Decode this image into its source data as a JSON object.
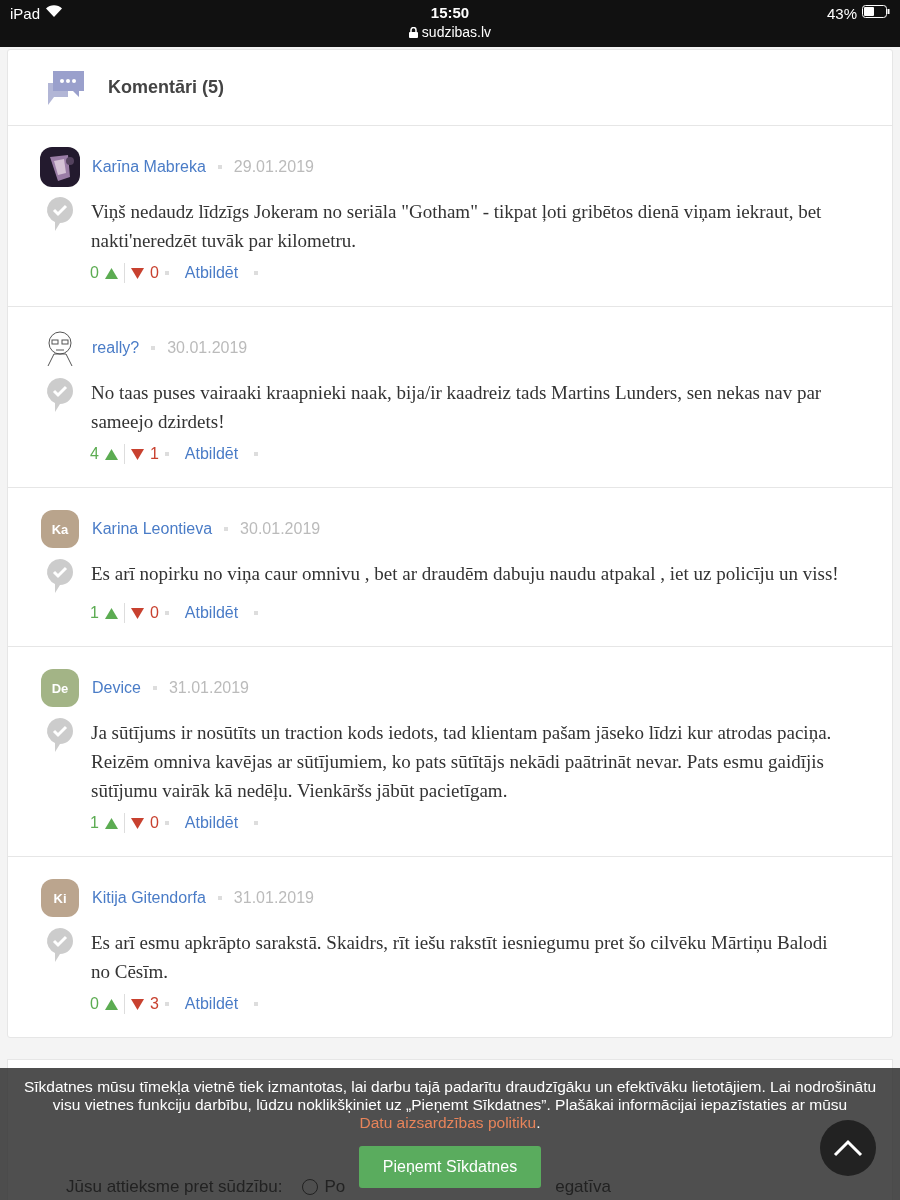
{
  "status_bar": {
    "device": "iPad",
    "time": "15:50",
    "url": "sudzibas.lv",
    "battery": "43%"
  },
  "comments_header": {
    "title": "Komentāri (5)"
  },
  "comments": [
    {
      "name": "Karīna Mabreka",
      "date": "29.01.2019",
      "text": "Viņš nedaudz līdzīgs Jokeram no seriāla \"Gotham\" - tikpat ļoti gribētos dienā viņam iekraut, bet nakti'neredzēt tuvāk par kilometru.",
      "up": "0",
      "down": "0",
      "reply": "Atbildēt"
    },
    {
      "avatar": {
        "kind": "drawing"
      },
      "name": "really?",
      "date": "30.01.2019",
      "text": "No taas puses vairaaki kraapnieki naak, bija/ir kaadreiz tads Martins Lunders, sen nekas nav par sameejo dzirdets!",
      "up": "4",
      "down": "1",
      "reply": "Atbildēt"
    },
    {
      "avatar": {
        "kind": "initials",
        "initials": "Ka",
        "color": "#b9a48c"
      },
      "name": "Karina Leontieva",
      "date": "30.01.2019",
      "text": "Es arī nopirku no viņa caur omnivu , bet ar draudēm dabuju naudu atpakal , iet uz policīju un viss!",
      "up": "1",
      "down": "0",
      "reply": "Atbildēt"
    },
    {
      "avatar": {
        "kind": "initials",
        "initials": "De",
        "color": "#a3b486"
      },
      "name": "Device",
      "date": "31.01.2019",
      "text": "Ja sūtījums ir nosūtīts un traction kods iedots, tad klientam pašam jāseko līdzi kur atrodas paciņa. Reizēm omniva kavējas ar sūtījumiem, ko pats sūtītājs nekādi paātrināt nevar. Pats esmu gaidījis sūtījumu vairāk kā nedēļu. Vienkāršs jābūt pacietīgam.",
      "up": "1",
      "down": "0",
      "reply": "Atbildēt"
    },
    {
      "avatar": {
        "kind": "initials",
        "initials": "Ki",
        "color": "#bba58e"
      },
      "name": "Kitija Gitendorfa",
      "date": "31.01.2019",
      "text": "Es arī esmu apkrāpto sarakstā. Skaidrs, rīt iešu rakstīt iesniegumu pret šo cilvēku Mārtiņu Balodi no Cēsīm.",
      "up": "0",
      "down": "3",
      "reply": "Atbildēt"
    }
  ],
  "form": {
    "attitude_label": "Jūsu attieksme pret sūdzību:",
    "options": [
      {
        "label": "Po",
        "selected": false
      },
      {
        "label": "egatīva"
      }
    ]
  },
  "cookie_banner": {
    "text_before": "Sīkdatnes mūsu tīmekļa vietnē tiek izmantotas, lai darbu tajā padarītu draudzīgāku un efektīvāku lietotājiem. Lai nodrošinātu visu vietnes funkciju darbību, lūdzu noklikšķiniet uz „Pieņemt Sīkdatnes”. Plašākai informācijai iepazīstaties ar mūsu ",
    "link": "Datu aizsardzības politiku",
    "text_after": ".",
    "button": "Pieņemt Sīkdatnes"
  }
}
